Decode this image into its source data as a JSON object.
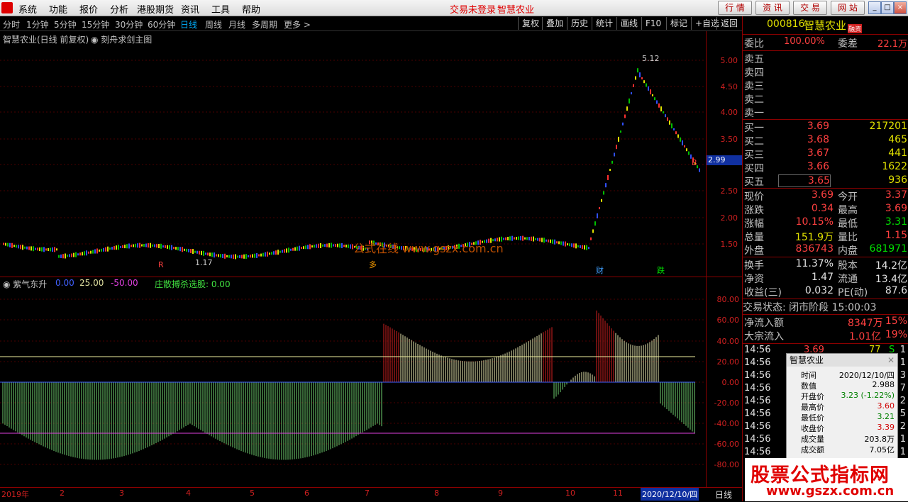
{
  "menubar": {
    "items": [
      "系统",
      "功能",
      "报价",
      "分析",
      "港股期货",
      "资讯",
      "工具",
      "帮助"
    ],
    "status": "交易未登录",
    "stock_name": "智慧农业",
    "buttons": [
      "行 情",
      "资 讯",
      "交 易",
      "网 站"
    ]
  },
  "periodbar": {
    "periods": [
      "分时",
      "1分钟",
      "5分钟",
      "15分钟",
      "30分钟",
      "60分钟",
      "日线",
      "周线",
      "月线",
      "多周期",
      "更多 >"
    ],
    "active": "日线",
    "tools": [
      "复权",
      "叠加",
      "历史",
      "统计",
      "画线",
      "F10",
      "标记",
      "+自选",
      "返回"
    ]
  },
  "main_chart": {
    "title": "智慧农业(日线 前复权)",
    "indicator": "刻舟求剑主图",
    "price_ticks": [
      "5.00",
      "4.50",
      "4.00",
      "3.50",
      "3.00",
      "2.50",
      "2.00",
      "1.50"
    ],
    "current_price_tag": "2.99",
    "high_annotation": "5.12",
    "low_annotation": "1.17",
    "markers": [
      "R",
      "B",
      "多",
      "财",
      "跌"
    ],
    "watermark_text": "公式在线 www.gszx.com.cn"
  },
  "sub_chart": {
    "title": "紫气东升",
    "v1": "0.00",
    "v2": "25.00",
    "v3": "-50.00",
    "extra": "庄散搏杀选股: 0.00",
    "ticks": [
      "80.00",
      "60.00",
      "40.00",
      "20.00",
      "0.00",
      "-20.00",
      "-40.00",
      "-60.00",
      "-80.00"
    ]
  },
  "xaxis": {
    "labels": [
      "2019年",
      "2",
      "3",
      "4",
      "5",
      "6",
      "7",
      "8",
      "9",
      "10",
      "11"
    ],
    "highlight_date": "2020/12/10/四",
    "period_label": "日线"
  },
  "quote": {
    "code": "000816",
    "name": "智慧农业",
    "badge": "融资",
    "weibi_label": "委比",
    "weibi": "100.00%",
    "weicha_label": "委差",
    "weicha": "22.1万",
    "sells": [
      "卖五",
      "卖四",
      "卖三",
      "卖二",
      "卖一"
    ],
    "buys": [
      {
        "label": "买一",
        "price": "3.69",
        "vol": "217201"
      },
      {
        "label": "买二",
        "price": "3.68",
        "vol": "465"
      },
      {
        "label": "买三",
        "price": "3.67",
        "vol": "441"
      },
      {
        "label": "买四",
        "price": "3.66",
        "vol": "1622"
      },
      {
        "label": "买五",
        "price": "3.65",
        "vol": "936"
      }
    ],
    "stats": [
      {
        "l1": "现价",
        "v1": "3.69",
        "c1": "red",
        "l2": "今开",
        "v2": "3.37",
        "c2": "red"
      },
      {
        "l1": "涨跌",
        "v1": "0.34",
        "c1": "red",
        "l2": "最高",
        "v2": "3.69",
        "c2": "red"
      },
      {
        "l1": "涨幅",
        "v1": "10.15%",
        "c1": "red",
        "l2": "最低",
        "v2": "3.31",
        "c2": "grn"
      },
      {
        "l1": "总量",
        "v1": "151.9万",
        "c1": "yel",
        "l2": "量比",
        "v2": "1.15",
        "c2": "red"
      },
      {
        "l1": "外盘",
        "v1": "836743",
        "c1": "red",
        "l2": "内盘",
        "v2": "681971",
        "c2": "grn"
      }
    ],
    "stats2": [
      {
        "l1": "换手",
        "v1": "11.37%",
        "l2": "股本",
        "v2": "14.2亿"
      },
      {
        "l1": "净资",
        "v1": "1.47",
        "l2": "流通",
        "v2": "13.4亿"
      },
      {
        "l1": "收益(三)",
        "v1": "0.032",
        "l2": "PE(动)",
        "v2": "87.6"
      }
    ],
    "trade_state": "交易状态: 闭市阶段 15:00:03",
    "net_inflow_label": "净流入额",
    "net_inflow": "8347万",
    "net_inflow_pct": "15%",
    "bulk_label": "大宗流入",
    "bulk": "1.01亿",
    "bulk_pct": "19%",
    "ticks": [
      {
        "t": "14:56",
        "p": "3.69",
        "v": "77",
        "s": "S",
        "n": "1"
      },
      {
        "t": "14:56",
        "n": "1"
      },
      {
        "t": "14:56",
        "n": "3"
      },
      {
        "t": "14:56",
        "n": "7"
      },
      {
        "t": "14:56",
        "n": "2"
      },
      {
        "t": "14:56",
        "n": "5"
      },
      {
        "t": "14:56",
        "n": "2"
      },
      {
        "t": "14:56",
        "n": "1"
      },
      {
        "t": "14:56",
        "n": "1"
      }
    ]
  },
  "popup": {
    "title": "智慧农业",
    "rows": [
      {
        "k": "时间",
        "v": "2020/12/10/四"
      },
      {
        "k": "数值",
        "v": "2.988"
      },
      {
        "k": "开盘价",
        "v": "3.23 (-1.22%)"
      },
      {
        "k": "最高价",
        "v": "3.60"
      },
      {
        "k": "最低价",
        "v": "3.21"
      },
      {
        "k": "收盘价",
        "v": "3.39"
      },
      {
        "k": "成交量",
        "v": "203.8万"
      },
      {
        "k": "成交额",
        "v": "7.05亿"
      }
    ]
  },
  "site_watermark": {
    "line1": "股票公式指标网",
    "line2": "www.gszx.com.cn"
  }
}
